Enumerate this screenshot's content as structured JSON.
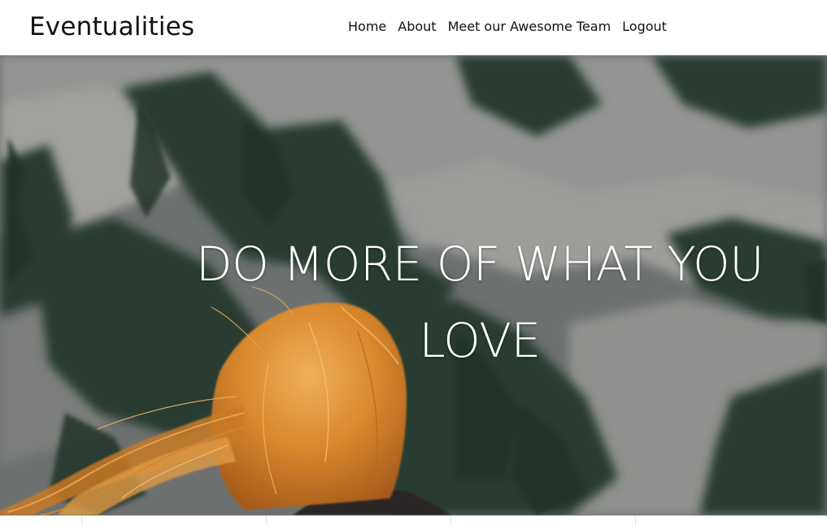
{
  "header": {
    "brand": "Eventualities",
    "nav": [
      {
        "label": "Home"
      },
      {
        "label": "About"
      },
      {
        "label": "Meet our Awesome Team"
      },
      {
        "label": "Logout"
      }
    ]
  },
  "hero": {
    "headline_line1": "DO MORE OF WHAT YOU",
    "headline_line2": "LOVE",
    "image_subject": "person with flowing red hair facing a forested mountainside"
  },
  "colors": {
    "header_bg": "#ffffff",
    "text": "#111111",
    "headline": "#ffffff",
    "hair": "#d68a2e",
    "forest": "#2f4636",
    "rock": "#9a9c9b"
  }
}
